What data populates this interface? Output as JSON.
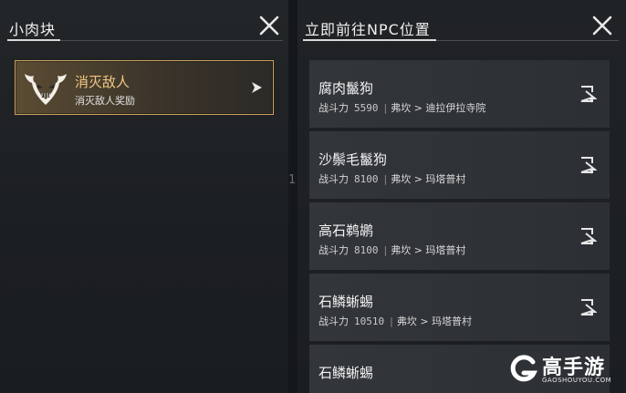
{
  "left_panel": {
    "title": "小肉块",
    "task": {
      "title": "消灭敌人",
      "subtitle": "消灭敌人奖励"
    }
  },
  "right_panel": {
    "title": "立即前往NPC位置",
    "power_label": "战斗力",
    "npcs": [
      {
        "name": "腐肉鬣狗",
        "power": "5590",
        "location": "弗坎 > 迪拉伊拉寺院"
      },
      {
        "name": "沙鬃毛鬣狗",
        "power": "8100",
        "location": "弗坎 > 玛塔普村"
      },
      {
        "name": "高石鹈鹕",
        "power": "8100",
        "location": "弗坎 > 玛塔普村"
      },
      {
        "name": "石鳞蜥蜴",
        "power": "10510",
        "location": "弗坎 > 玛塔普村"
      },
      {
        "name": "石鳞蜥蜴",
        "power": "",
        "location": ""
      }
    ]
  },
  "divider_glyph": "1",
  "watermark": {
    "text": "高手游",
    "url": "GAOSHOUYOU.COM"
  },
  "colors": {
    "accent_gold": "#c9a25d",
    "task_title": "#f1c784"
  },
  "icons": {
    "close": "close-icon",
    "task_emblem": "demon-mask-icon",
    "task_arrow": "chevron-right-icon",
    "npc_go": "navigate-icon"
  }
}
